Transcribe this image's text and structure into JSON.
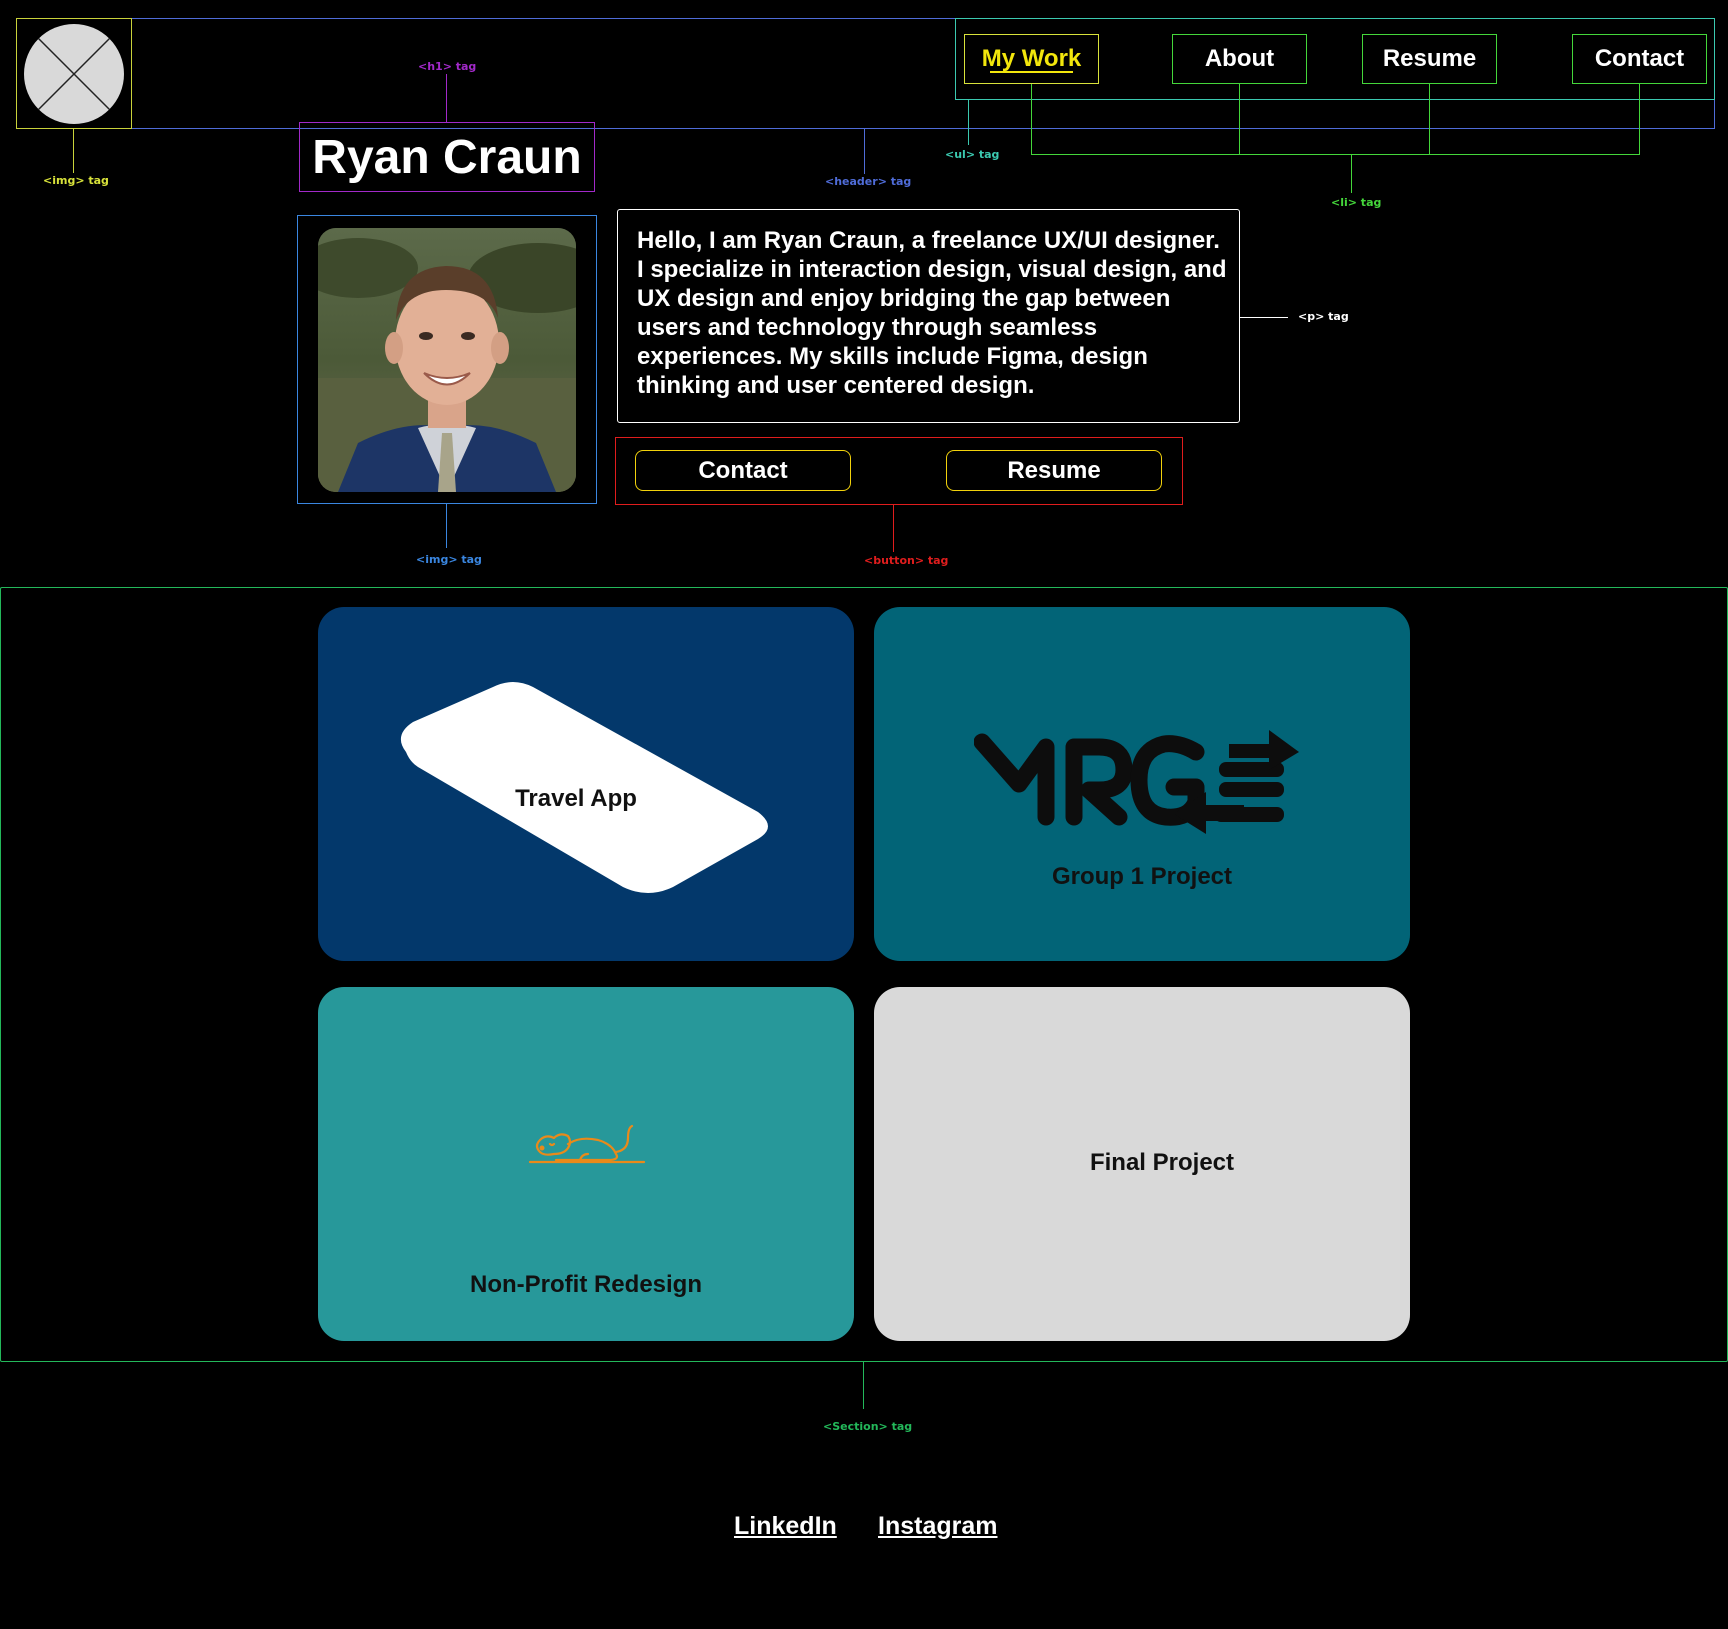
{
  "header": {
    "name": "Ryan Craun",
    "nav": [
      {
        "label": "My Work"
      },
      {
        "label": "About"
      },
      {
        "label": "Resume"
      },
      {
        "label": "Contact"
      }
    ]
  },
  "hero": {
    "bio": "Hello, I am Ryan Craun, a freelance UX/UI designer. I specialize in interaction design, visual design, and UX design and enjoy bridging the gap between users and technology through seamless experiences. My skills include Figma, design thinking and user centered design.",
    "buttons": {
      "contact": "Contact",
      "resume": "Resume"
    }
  },
  "projects": [
    {
      "label": "Travel App",
      "color": "#03386b"
    },
    {
      "label": "Group 1 Project",
      "color": "#026477"
    },
    {
      "label": "Non-Profit Redesign",
      "color": "#27989a"
    },
    {
      "label": "Final Project",
      "color": "#d9d9d9"
    }
  ],
  "footer": {
    "linkedin": "LinkedIn",
    "instagram": "Instagram"
  },
  "annotations": {
    "img_logo": "<img> tag",
    "h1": "<h1> tag",
    "header": "<header> tag",
    "ul": "<ul> tag",
    "li": "<li> tag",
    "p": "<p> tag",
    "img_photo": "<img> tag",
    "button": "<button> tag",
    "section": "<Section> tag"
  },
  "colors": {
    "active_nav": "#f2e60c",
    "nav_border": "#44d63a",
    "header_outline": "#4f6cd8",
    "section_outline": "#23b85a",
    "button_outline": "#e01d1d"
  }
}
